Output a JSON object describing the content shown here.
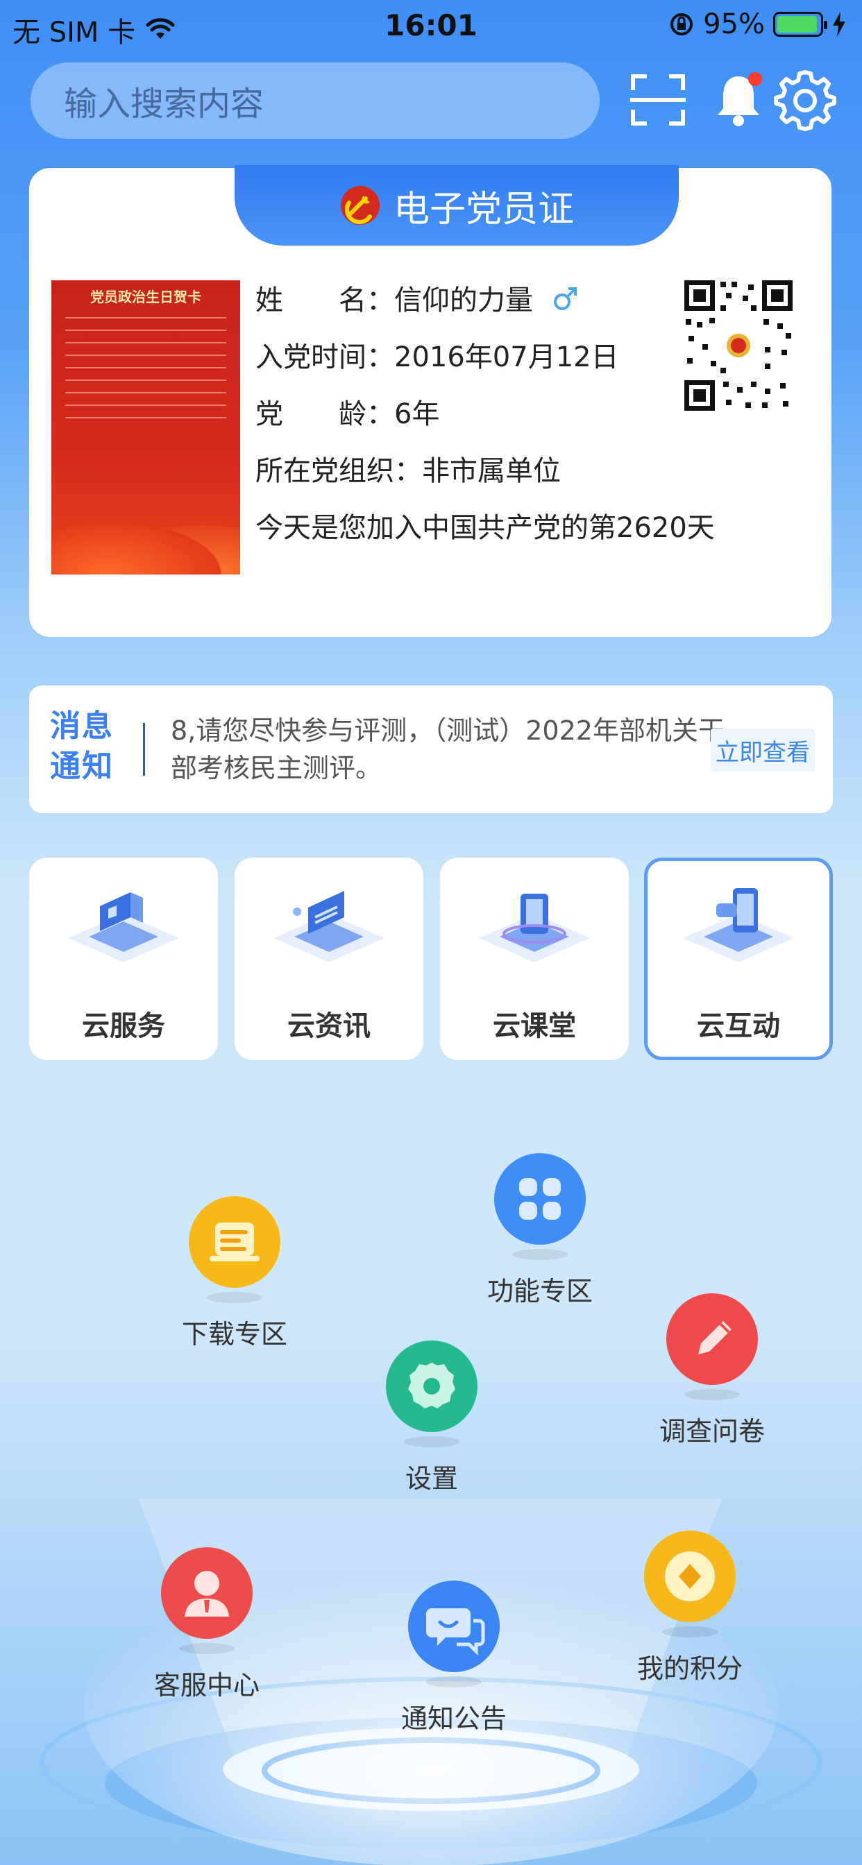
{
  "status_bar": {
    "carrier": "无 SIM 卡",
    "time": "16:01",
    "battery": "95%",
    "battery_level": 0.95
  },
  "header": {
    "search_placeholder": "输入搜索内容",
    "icons": [
      "scan-icon",
      "bell-icon",
      "gear-icon"
    ]
  },
  "card": {
    "title": "电子党员证",
    "photo": {
      "title": "党员政治生日贺卡"
    },
    "fields": {
      "name_label": "姓　　名：",
      "name_value": "信仰的力量",
      "join_label": "入党时间：",
      "join_value": "2016年07月12日",
      "age_label": "党　　龄：",
      "age_value": "6年",
      "org_label": "所在党组织：",
      "org_value": "非市属单位",
      "days_text": "今天是您加入中国共产党的第2620天"
    }
  },
  "notice": {
    "badge_line1": "消息",
    "badge_line2": "通知",
    "text": "8,请您尽快参与评测，（测试）2022年部机关干部考核民主测评。",
    "action": "立即查看"
  },
  "tiles": [
    {
      "label": "云服务"
    },
    {
      "label": "云资讯"
    },
    {
      "label": "云课堂"
    },
    {
      "label": "云互动"
    }
  ],
  "features": {
    "download": "下载专区",
    "function": "功能专区",
    "survey": "调查问卷",
    "settings": "设置",
    "service": "客服中心",
    "notice": "通知公告",
    "points": "我的积分"
  },
  "colors": {
    "primary": "#3b7ff0",
    "party_red": "#d52a1e",
    "gender_blue": "#4aa8e8"
  }
}
